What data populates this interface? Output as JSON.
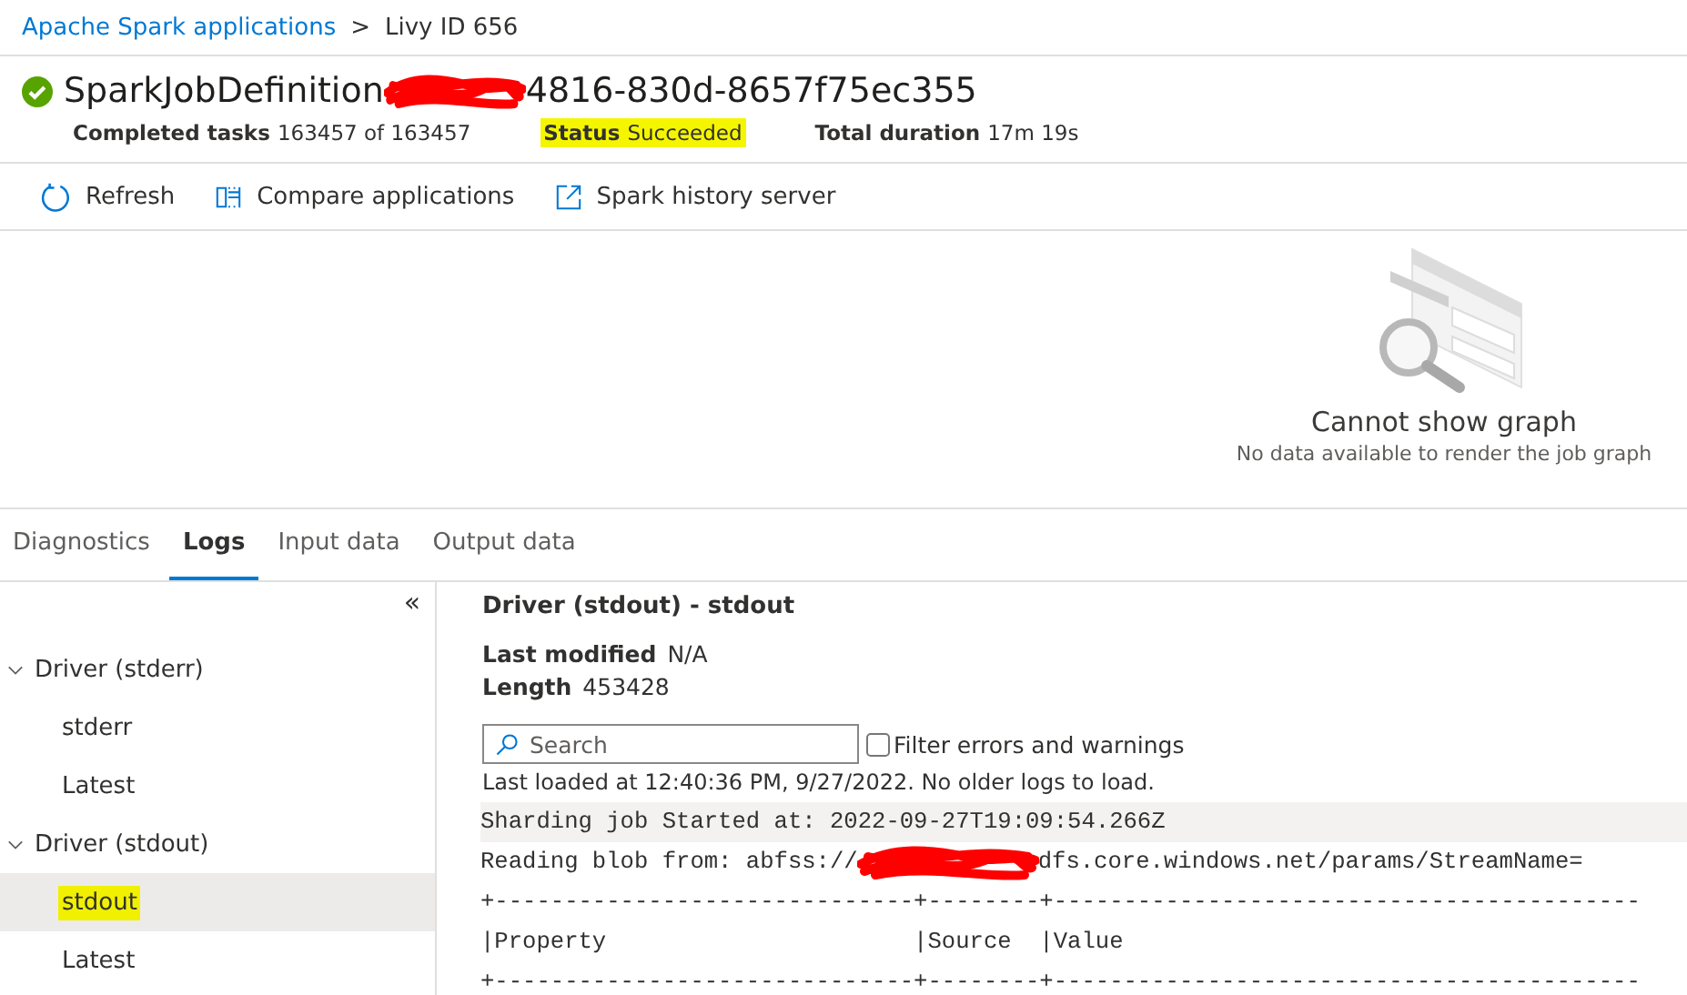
{
  "breadcrumb": {
    "items": [
      {
        "label": "Apache Spark applications",
        "kind": "link"
      },
      {
        "label": ">",
        "kind": "separator"
      },
      {
        "label": "Livy ID 656",
        "kind": "current"
      }
    ]
  },
  "header": {
    "title_start": "SparkJobDefinition",
    "title_end": "4816-830d-8657f75ec355",
    "redacted": true,
    "stats": [
      {
        "label": "Completed tasks",
        "value": "163457 of 163457",
        "highlighted": false
      },
      {
        "label": "Status",
        "value": "Succeeded",
        "highlighted": true
      },
      {
        "label": "Total duration",
        "value": "17m 19s",
        "highlighted": false
      }
    ]
  },
  "toolbar": [
    {
      "label": "Refresh"
    },
    {
      "label": "Compare applications"
    },
    {
      "label": "Spark history server"
    }
  ],
  "graph": {
    "title": "Cannot show graph",
    "message": "No data available to render the job graph"
  },
  "tabs": [
    {
      "label": "Diagnostics",
      "selected": false
    },
    {
      "label": "Logs",
      "selected": true
    },
    {
      "label": "Input data",
      "selected": false
    },
    {
      "label": "Output data",
      "selected": false
    }
  ],
  "collapse_glyph": "«",
  "tree": [
    {
      "label": "Driver (stderr)",
      "expanded": true,
      "children": [
        {
          "label": "stderr",
          "selected": false,
          "highlighted": false
        },
        {
          "label": "Latest",
          "selected": false,
          "highlighted": false
        }
      ]
    },
    {
      "label": "Driver (stdout)",
      "expanded": true,
      "children": [
        {
          "label": "stdout",
          "selected": true,
          "highlighted": true
        },
        {
          "label": "Latest",
          "selected": false,
          "highlighted": false
        }
      ]
    }
  ],
  "log": {
    "title": "Driver (stdout) - stdout",
    "fields": [
      {
        "label": "Last modified",
        "value": "N/A"
      },
      {
        "label": "Length",
        "value": "453428"
      }
    ],
    "search": {
      "placeholder": "Search"
    },
    "filter": {
      "label": "Filter errors and warnings",
      "checked": false
    },
    "loaded": "Last loaded at 12:40:36 PM, 9/27/2022. No older logs to load.",
    "lines": [
      {
        "text": "Sharding job Started at: 2022-09-27T19:09:54.266Z",
        "shaded": true
      },
      {
        "text": "Reading blob from: abfss://",
        "text_end": "dfs.core.windows.net/params/StreamName=",
        "redacted": true,
        "shaded": false
      },
      {
        "text": "+------------------------------+--------+------------------------------------------",
        "shaded": false
      },
      {
        "text": "|Property                      |Source  |Value",
        "shaded": false
      },
      {
        "text": "+------------------------------+--------+------------------------------------------",
        "shaded": false
      }
    ]
  }
}
